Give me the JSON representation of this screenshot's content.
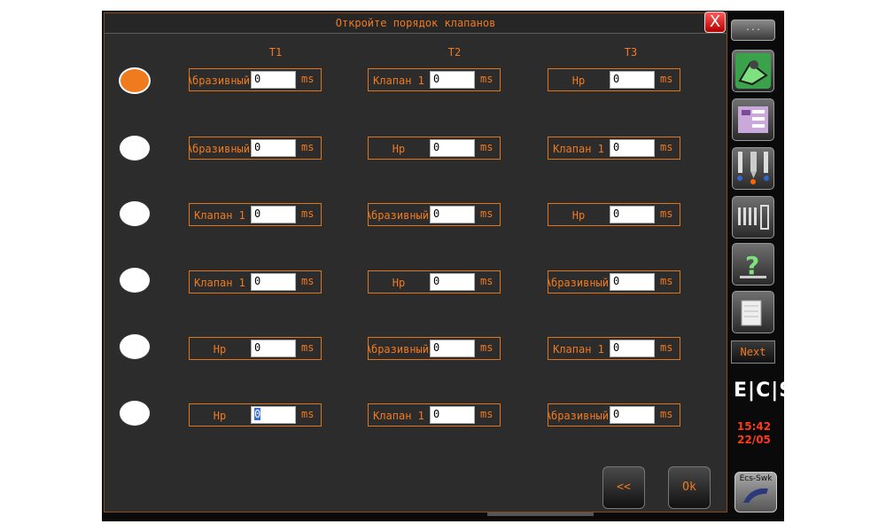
{
  "dialog": {
    "title": "Откройте порядок клапанов",
    "close_label": "X",
    "columns": [
      "T1",
      "T2",
      "T3"
    ],
    "unit": "ms",
    "rows": [
      {
        "selected": true,
        "cells": [
          {
            "label": "Абразивный",
            "value": "0"
          },
          {
            "label": "Клапан 1",
            "value": "0"
          },
          {
            "label": "Нр",
            "value": "0"
          }
        ]
      },
      {
        "selected": false,
        "cells": [
          {
            "label": "Абразивный",
            "value": "0"
          },
          {
            "label": "Нр",
            "value": "0"
          },
          {
            "label": "Клапан 1",
            "value": "0"
          }
        ]
      },
      {
        "selected": false,
        "cells": [
          {
            "label": "Клапан 1",
            "value": "0"
          },
          {
            "label": "Абразивный",
            "value": "0"
          },
          {
            "label": "Нр",
            "value": "0"
          }
        ]
      },
      {
        "selected": false,
        "cells": [
          {
            "label": "Клапан 1",
            "value": "0"
          },
          {
            "label": "Нр",
            "value": "0"
          },
          {
            "label": "Абразивный",
            "value": "0"
          }
        ]
      },
      {
        "selected": false,
        "cells": [
          {
            "label": "Нр",
            "value": "0"
          },
          {
            "label": "Абразивный",
            "value": "0"
          },
          {
            "label": "Клапан 1",
            "value": "0"
          }
        ]
      },
      {
        "selected": false,
        "cells": [
          {
            "label": "Нр",
            "value": "0",
            "focused": true
          },
          {
            "label": "Клапан 1",
            "value": "0"
          },
          {
            "label": "Абразивный",
            "value": "0"
          }
        ]
      }
    ],
    "back_label": "<<",
    "ok_label": "Ok"
  },
  "sidebar": {
    "dots_label": "...",
    "buttons": [
      "valve-icon",
      "settings-list-icon",
      "nozzle-icon",
      "gauge-icon",
      "help-icon",
      "document-icon"
    ],
    "next_label": "Next",
    "logo": "E|C|S",
    "time": "15:42",
    "date": "22/05",
    "app_label": "Ecs-Swk"
  },
  "colors": {
    "accent": "#f07a1e",
    "background": "#2c2c2c",
    "clock": "#ff3a1a"
  }
}
